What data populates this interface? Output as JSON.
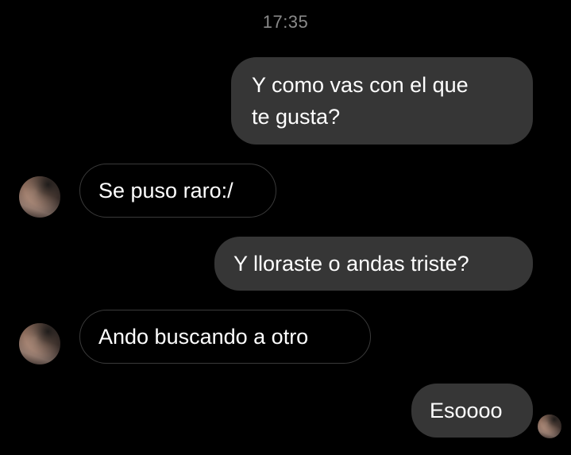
{
  "chat": {
    "timestamp": "17:35",
    "messages": [
      {
        "direction": "outgoing",
        "text": "Y como vas con el que\nte gusta?"
      },
      {
        "direction": "incoming",
        "text": "Se puso raro:/"
      },
      {
        "direction": "outgoing",
        "text": "Y lloraste o andas triste?"
      },
      {
        "direction": "incoming",
        "text": "Ando buscando a otro"
      },
      {
        "direction": "outgoing",
        "text": "Esoooo"
      }
    ]
  },
  "colors": {
    "background": "#000000",
    "outgoing_bubble": "#363636",
    "incoming_border": "#3a3a3a",
    "timestamp_text": "#8a8a8a",
    "message_text": "#ffffff"
  },
  "icons": {
    "contact_avatar": "contact-avatar-icon",
    "seen_avatar": "seen-avatar-icon"
  }
}
